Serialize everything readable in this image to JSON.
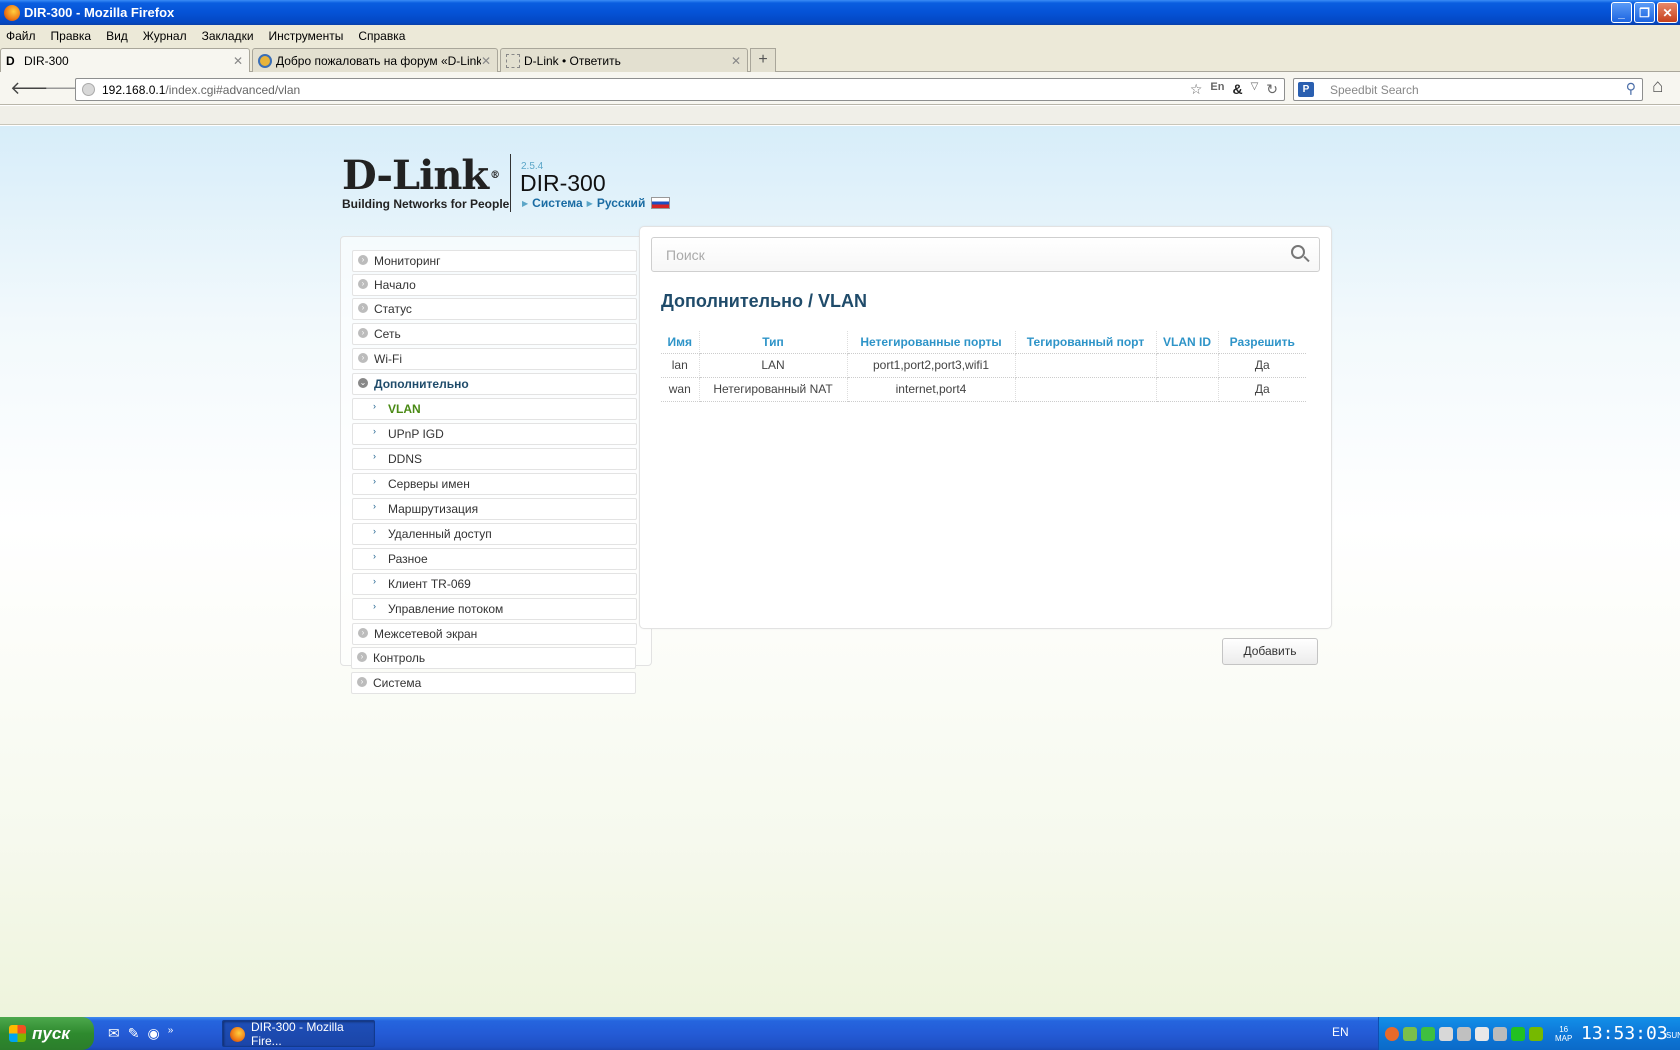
{
  "window": {
    "title": "DIR-300 - Mozilla Firefox"
  },
  "menubar": [
    "Файл",
    "Правка",
    "Вид",
    "Журнал",
    "Закладки",
    "Инструменты",
    "Справка"
  ],
  "tabs": [
    {
      "label": "DIR-300"
    },
    {
      "label": "Добро пожаловать на форум «D-Link» ..."
    },
    {
      "label": "D-Link • Ответить"
    }
  ],
  "urlbar": {
    "host": "192.168.0.1",
    "path": "/index.cgi#advanced/vlan"
  },
  "searchbar": {
    "placeholder": "Speedbit Search"
  },
  "router": {
    "brand": "D-Link",
    "tagline": "Building Networks for People",
    "firmware": "2.5.4",
    "model": "DIR-300",
    "link_system": "Система",
    "link_language": "Русский"
  },
  "sidebar": {
    "items": [
      {
        "label": "Мониторинг"
      },
      {
        "label": "Начало"
      },
      {
        "label": "Статус"
      },
      {
        "label": "Сеть"
      },
      {
        "label": "Wi-Fi"
      },
      {
        "label": "Дополнительно"
      },
      {
        "label": "VLAN"
      },
      {
        "label": "UPnP IGD"
      },
      {
        "label": "DDNS"
      },
      {
        "label": "Серверы имен"
      },
      {
        "label": "Маршрутизация"
      },
      {
        "label": "Удаленный доступ"
      },
      {
        "label": "Разное"
      },
      {
        "label": "Клиент TR-069"
      },
      {
        "label": "Управление потоком"
      },
      {
        "label": "Межсетевой экран"
      },
      {
        "label": "Контроль"
      },
      {
        "label": "Система"
      }
    ]
  },
  "main": {
    "search_placeholder": "Поиск",
    "breadcrumb": "Дополнительно /  VLAN",
    "table": {
      "headers": [
        "Имя",
        "Тип",
        "Нетегированные порты",
        "Тегированный порт",
        "VLAN ID",
        "Разрешить"
      ],
      "rows": [
        [
          "lan",
          "LAN",
          "port1,port2,port3,wifi1",
          "",
          "",
          "Да"
        ],
        [
          "wan",
          "Нетегированный NAT",
          "internet,port4",
          "",
          "",
          "Да"
        ]
      ]
    },
    "add_button": "Добавить"
  },
  "taskbar": {
    "start_label": "пуск",
    "task_label": "DIR-300 - Mozilla Fire...",
    "lang": "EN",
    "date_day": "16",
    "date_month": "МАР",
    "time": "13:53:03",
    "weekday": "SUN"
  }
}
